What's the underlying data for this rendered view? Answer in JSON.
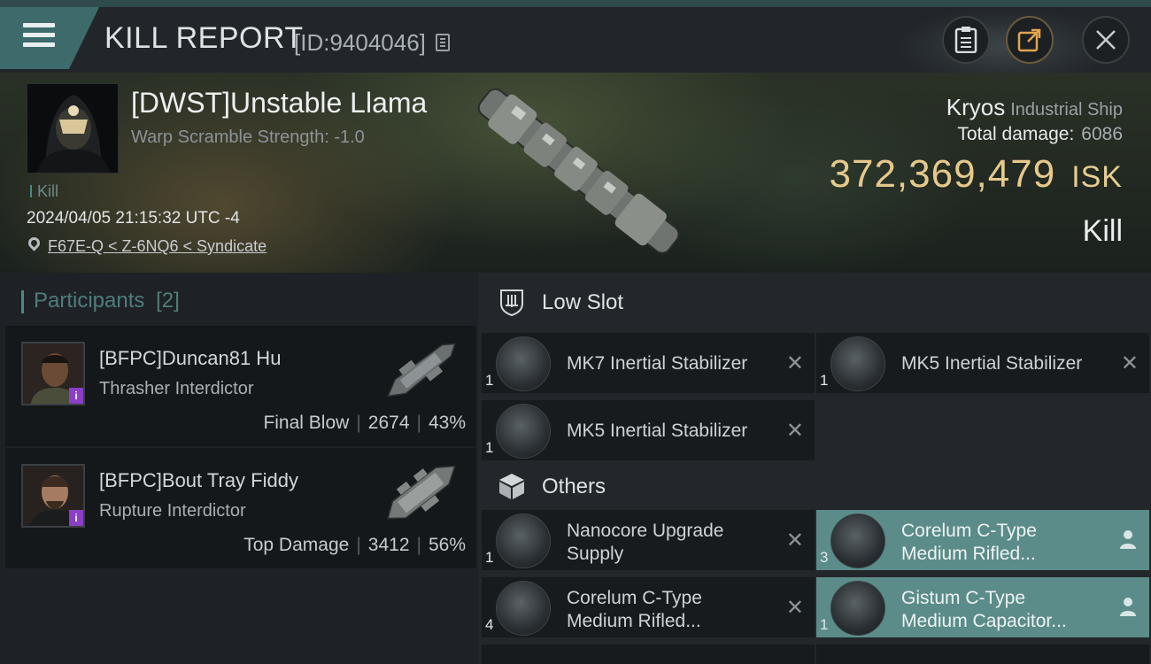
{
  "header": {
    "title": "KILL REPORT",
    "kill_id": "[ID:9404046]"
  },
  "victim": {
    "name": "[DWST]Unstable Llama",
    "warp_scramble": "Warp Scramble Strength: -1.0",
    "tag": "Kill",
    "datetime": "2024/04/05 21:15:32 UTC -4",
    "location": "F67E-Q < Z-6NQ6 < Syndicate",
    "ship": "Kryos",
    "ship_class": "Industrial Ship",
    "total_damage_label": "Total damage:",
    "total_damage": "6086",
    "isk_value": "372,369,479",
    "isk_unit": "ISK",
    "result": "Kill"
  },
  "participants": {
    "title": "Participants",
    "count": "[2]",
    "list": [
      {
        "name": "[BFPC]Duncan81 Hu",
        "ship": "Thrasher Interdictor",
        "role": "Final Blow",
        "damage": "2674",
        "percent": "43%"
      },
      {
        "name": "[BFPC]Bout Tray Fiddy",
        "ship": "Rupture Interdictor",
        "role": "Top Damage",
        "damage": "3412",
        "percent": "56%"
      }
    ]
  },
  "low_slot": {
    "title": "Low Slot",
    "items": [
      {
        "name": "MK7 Inertial Stabilizer",
        "qty": "1"
      },
      {
        "name": "MK5 Inertial Stabilizer",
        "qty": "1"
      },
      {
        "name": "MK5 Inertial Stabilizer",
        "qty": "1"
      }
    ]
  },
  "others": {
    "title": "Others",
    "items": [
      {
        "name_l1": "Nanocore Upgrade",
        "name_l2": "Supply",
        "qty": "1"
      },
      {
        "name_l1": "Corelum C-Type",
        "name_l2": "Medium Rifled...",
        "qty": "3"
      },
      {
        "name_l1": "Corelum C-Type",
        "name_l2": "Medium Rifled...",
        "qty": "4"
      },
      {
        "name_l1": "Gistum C-Type",
        "name_l2": "Medium Capacitor...",
        "qty": "1"
      }
    ]
  },
  "colors": {
    "accent_teal": "#4a8a86",
    "isk_gold": "#e6c98b",
    "highlight_row": "#5b8c89",
    "info_badge": "#8b3ec6"
  }
}
